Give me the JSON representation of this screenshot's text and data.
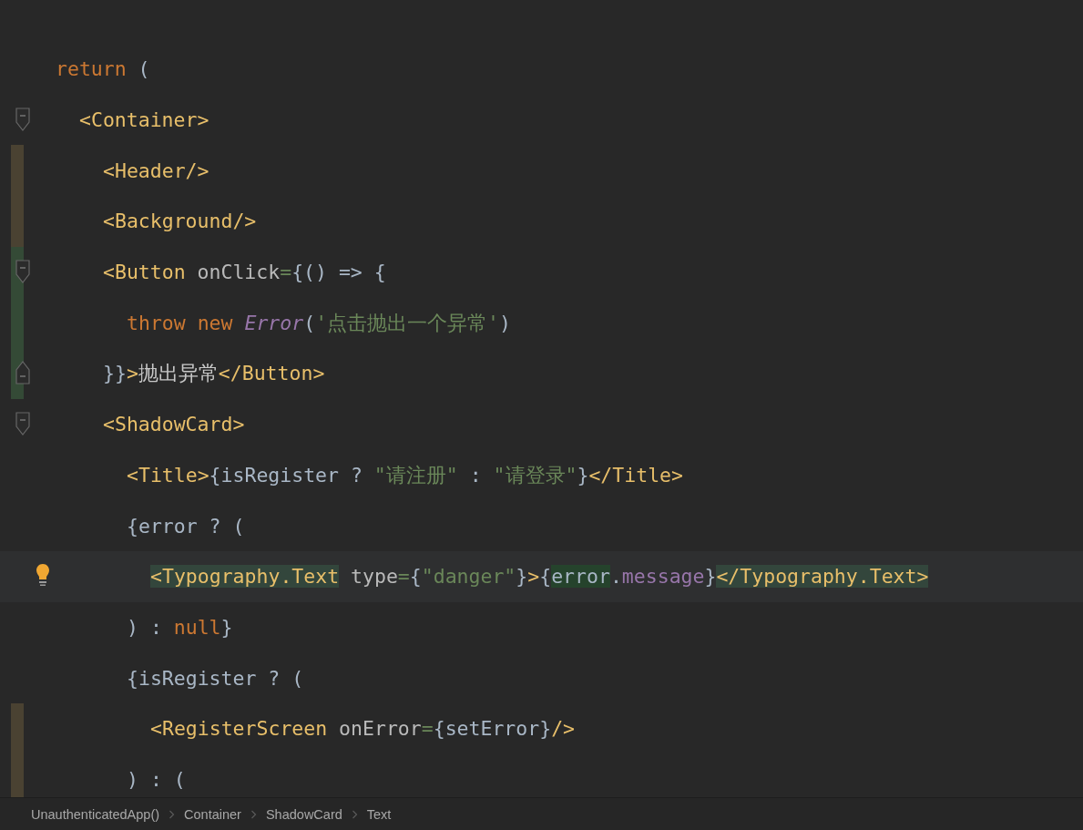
{
  "editor": {
    "lines": [
      {
        "tokens": [
          {
            "kind": "keyword",
            "text": "return"
          },
          {
            "kind": "plain",
            "text": " ("
          }
        ],
        "children": [
          {
            "fold_start": true,
            "tokens": [
              {
                "kind": "tag",
                "text": "<Container>"
              }
            ],
            "children": [
              {
                "modified": true,
                "tokens": [
                  {
                    "kind": "tag",
                    "text": "<Header/>"
                  }
                ]
              },
              {
                "modified": true,
                "tokens": [
                  {
                    "kind": "tag",
                    "text": "<Background/>"
                  }
                ]
              },
              {
                "added": true,
                "fold_start": true,
                "tokens": [
                  {
                    "kind": "tag",
                    "text": "<Button"
                  },
                  {
                    "kind": "attr",
                    "text": " onClick"
                  },
                  {
                    "kind": "op",
                    "text": "="
                  },
                  {
                    "kind": "plain",
                    "text": "{() => {"
                  }
                ],
                "children": [
                  {
                    "added": true,
                    "tokens": [
                      {
                        "kind": "keyword",
                        "text": "throw new "
                      },
                      {
                        "kind": "class",
                        "text": "Error"
                      },
                      {
                        "kind": "plain",
                        "text": "("
                      },
                      {
                        "kind": "string",
                        "text": "'点击抛出一个异常'"
                      },
                      {
                        "kind": "plain",
                        "text": ")"
                      }
                    ]
                  }
                ]
              },
              {
                "added": true,
                "fold_end": true,
                "tokens": [
                  {
                    "kind": "plain",
                    "text": "}}"
                  },
                  {
                    "kind": "tag",
                    "text": ">"
                  },
                  {
                    "kind": "text",
                    "text": "抛出异常"
                  },
                  {
                    "kind": "tag",
                    "text": "</Button>"
                  }
                ]
              },
              {
                "fold_start": true,
                "tokens": [
                  {
                    "kind": "tag",
                    "text": "<ShadowCard>"
                  }
                ],
                "children": [
                  {
                    "tokens": [
                      {
                        "kind": "tag",
                        "text": "<Title>"
                      },
                      {
                        "kind": "plain",
                        "text": "{isRegister ? "
                      },
                      {
                        "kind": "string",
                        "text": "\"请注册\""
                      },
                      {
                        "kind": "plain",
                        "text": " : "
                      },
                      {
                        "kind": "string",
                        "text": "\"请登录\""
                      },
                      {
                        "kind": "plain",
                        "text": "}"
                      },
                      {
                        "kind": "tag",
                        "text": "</Title>"
                      }
                    ]
                  },
                  {
                    "tokens": [
                      {
                        "kind": "plain",
                        "text": "{error ? ("
                      }
                    ],
                    "children": [
                      {
                        "current": true,
                        "tokens": [
                          {
                            "kind": "tag",
                            "text": "<Typography.Text",
                            "highlight": true
                          },
                          {
                            "kind": "attr",
                            "text": " type"
                          },
                          {
                            "kind": "op",
                            "text": "="
                          },
                          {
                            "kind": "plain",
                            "text": "{"
                          },
                          {
                            "kind": "string",
                            "text": "\"danger\""
                          },
                          {
                            "kind": "plain",
                            "text": "}"
                          },
                          {
                            "kind": "tag",
                            "text": ">"
                          },
                          {
                            "kind": "plain",
                            "text": "{"
                          },
                          {
                            "kind": "plain",
                            "text": "error",
                            "highlight": true
                          },
                          {
                            "kind": "plain",
                            "text": "."
                          },
                          {
                            "kind": "field",
                            "text": "message"
                          },
                          {
                            "kind": "plain",
                            "text": "}"
                          },
                          {
                            "kind": "tag",
                            "text": "</Typography.Text>",
                            "highlight": true
                          }
                        ]
                      }
                    ]
                  },
                  {
                    "tokens": [
                      {
                        "kind": "plain",
                        "text": ") : "
                      },
                      {
                        "kind": "keyword",
                        "text": "null"
                      },
                      {
                        "kind": "plain",
                        "text": "}"
                      }
                    ]
                  },
                  {
                    "tokens": [
                      {
                        "kind": "plain",
                        "text": "{isRegister ? ("
                      }
                    ],
                    "children": [
                      {
                        "modified": true,
                        "tokens": [
                          {
                            "kind": "tag",
                            "text": "<RegisterScreen"
                          },
                          {
                            "kind": "attr",
                            "text": " onError"
                          },
                          {
                            "kind": "op",
                            "text": "="
                          },
                          {
                            "kind": "plain",
                            "text": "{setError}"
                          },
                          {
                            "kind": "tag",
                            "text": "/>"
                          }
                        ]
                      }
                    ]
                  },
                  {
                    "modified": true,
                    "tokens": [
                      {
                        "kind": "plain",
                        "text": ") : ("
                      }
                    ]
                  }
                ]
              }
            ]
          }
        ]
      }
    ]
  },
  "breadcrumbs": [
    "UnauthenticatedApp()",
    "Container",
    "ShadowCard",
    "Text"
  ]
}
